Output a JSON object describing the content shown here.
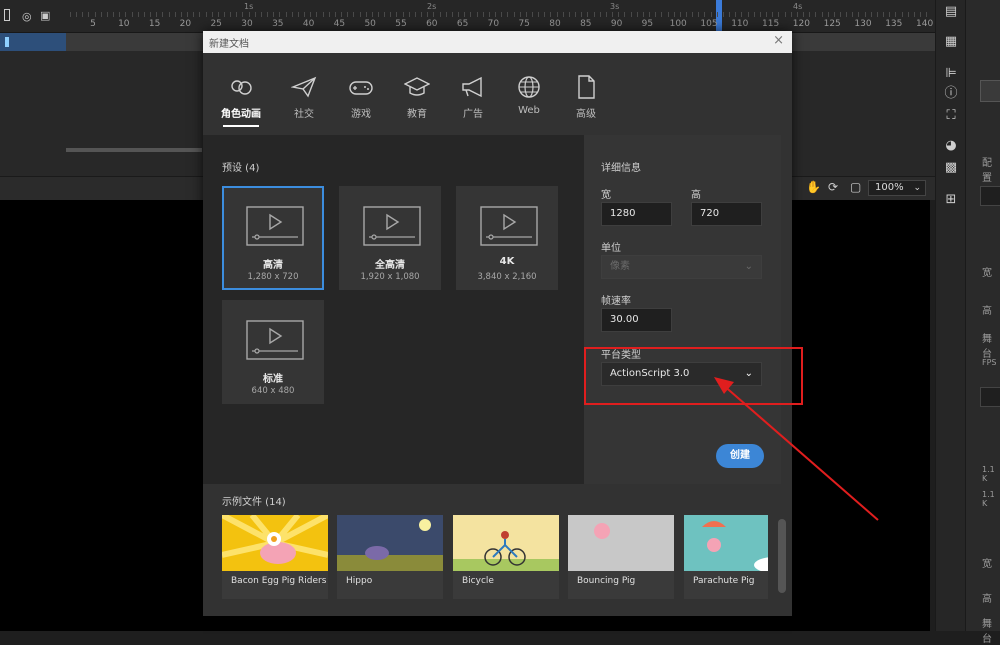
{
  "timeline": {
    "seconds": [
      "1s",
      "2s",
      "3s",
      "4s"
    ],
    "frame_ticks": [
      "5",
      "10",
      "15",
      "20",
      "25",
      "30",
      "35",
      "40",
      "45",
      "50",
      "55",
      "60",
      "65",
      "70",
      "75",
      "80",
      "85",
      "90",
      "95",
      "100",
      "105",
      "110",
      "115",
      "120",
      "125",
      "130",
      "135",
      "140",
      "14"
    ]
  },
  "stage_toolbar": {
    "zoom": "100%"
  },
  "dialog": {
    "title": "新建文档",
    "close_glyph": "×",
    "categories": [
      {
        "label": "角色动画",
        "active": true
      },
      {
        "label": "社交"
      },
      {
        "label": "游戏"
      },
      {
        "label": "教育"
      },
      {
        "label": "广告"
      },
      {
        "label": "Web"
      },
      {
        "label": "高级"
      }
    ],
    "presets_title": "预设 (4)",
    "presets": [
      {
        "name": "高清",
        "dims": "1,280 x 720",
        "selected": true
      },
      {
        "name": "全高清",
        "dims": "1,920 x 1,080"
      },
      {
        "name": "4K",
        "dims": "3,840 x 2,160"
      },
      {
        "name": "标准",
        "dims": "640 x 480"
      }
    ],
    "details": {
      "title": "详细信息",
      "width_label": "宽",
      "width_value": "1280",
      "height_label": "高",
      "height_value": "720",
      "unit_label": "单位",
      "unit_value": "像素",
      "fps_label": "帧速率",
      "fps_value": "30.00",
      "platform_label": "平台类型",
      "platform_value": "ActionScript 3.0",
      "create_label": "创建"
    },
    "samples_title": "示例文件 (14)",
    "samples": [
      {
        "name": "Bacon Egg Pig Riders"
      },
      {
        "name": "Hippo"
      },
      {
        "name": "Bicycle"
      },
      {
        "name": "Bouncing Pig"
      },
      {
        "name": "Parachute Pig"
      }
    ]
  },
  "props_panel": {
    "labels": [
      "配置",
      "宽",
      "高",
      "舞台",
      "FPS",
      "1.1 K",
      "1.1 K",
      "宽",
      "高",
      "舞台"
    ]
  },
  "colors": {
    "accent": "#3c86d6",
    "annotation": "#e01e1e"
  }
}
